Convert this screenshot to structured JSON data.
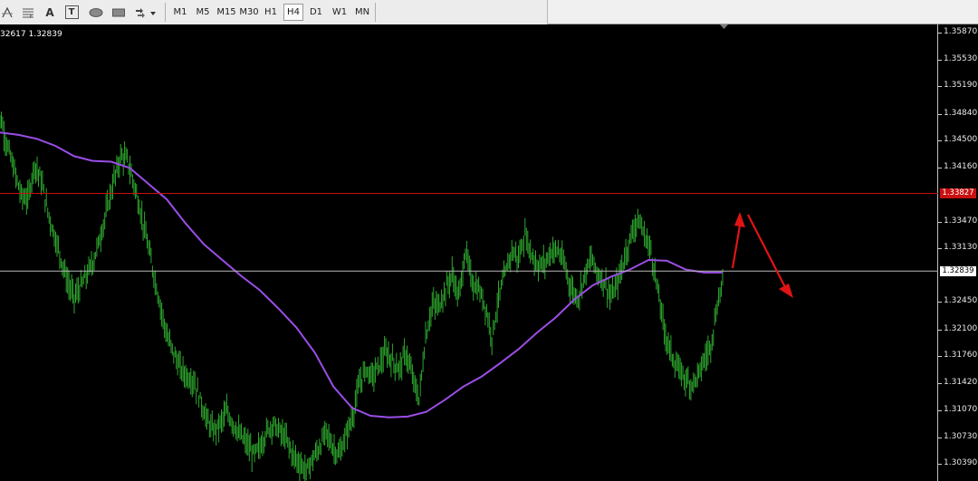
{
  "toolbar": {
    "tools": [
      {
        "name": "crosshair-icon"
      },
      {
        "name": "fibonacci-icon"
      },
      {
        "name": "text-icon",
        "label": "A"
      },
      {
        "name": "text-label-icon",
        "label": "T"
      },
      {
        "name": "ellipse-icon"
      },
      {
        "name": "rectangle-icon"
      },
      {
        "name": "arrows-icon"
      }
    ],
    "timeframes": [
      "M1",
      "M5",
      "M15",
      "M30",
      "H1",
      "H4",
      "D1",
      "W1",
      "MN"
    ],
    "active_timeframe": "H4"
  },
  "ohlc_text": "32617 1.32839",
  "chart_data": {
    "type": "line",
    "title": "",
    "y_axis_ticks": [
      "1.35870",
      "1.35530",
      "1.35190",
      "1.34840",
      "1.34500",
      "1.34160",
      "1.33470",
      "1.33130",
      "1.32450",
      "1.32100",
      "1.31760",
      "1.31420",
      "1.31070",
      "1.30730",
      "1.30390"
    ],
    "ylim": [
      1.302,
      1.36
    ],
    "horizontal_lines": [
      {
        "price": 1.33827,
        "label": "1.33827",
        "color": "#c81010"
      },
      {
        "price": 1.32839,
        "label": "1.32839",
        "color": "#b8b8b8"
      }
    ],
    "series": [
      {
        "style": "bars",
        "color": "#2ea82e",
        "values": [
          1.3475,
          1.344,
          1.341,
          1.338,
          1.3375,
          1.342,
          1.34,
          1.336,
          1.333,
          1.33,
          1.327,
          1.325,
          1.3265,
          1.328,
          1.33,
          1.333,
          1.3365,
          1.34,
          1.343,
          1.3425,
          1.3395,
          1.336,
          1.332,
          1.328,
          1.324,
          1.32,
          1.318,
          1.316,
          1.315,
          1.3145,
          1.312,
          1.3095,
          1.308,
          1.309,
          1.3105,
          1.309,
          1.3075,
          1.3065,
          1.305,
          1.306,
          1.308,
          1.309,
          1.308,
          1.307,
          1.305,
          1.304,
          1.303,
          1.3045,
          1.306,
          1.308,
          1.306,
          1.305,
          1.3075,
          1.31,
          1.314,
          1.316,
          1.315,
          1.3165,
          1.318,
          1.317,
          1.316,
          1.318,
          1.315,
          1.312,
          1.32,
          1.324,
          1.324,
          1.326,
          1.328,
          1.325,
          1.331,
          1.327,
          1.326,
          1.324,
          1.32,
          1.325,
          1.328,
          1.331,
          1.33,
          1.333,
          1.3305,
          1.329,
          1.3295,
          1.331,
          1.331,
          1.329,
          1.326,
          1.325,
          1.328,
          1.33,
          1.328,
          1.327,
          1.325,
          1.327,
          1.33,
          1.333,
          1.335,
          1.333,
          1.331,
          1.326,
          1.321,
          1.318,
          1.316,
          1.315,
          1.314,
          1.315,
          1.317,
          1.319,
          1.324,
          1.328
        ],
        "trend": [
          1.346,
          1.3457,
          1.3452,
          1.3443,
          1.343,
          1.3424,
          1.3423,
          1.3415,
          1.3395,
          1.3375,
          1.3345,
          1.3318,
          1.3298,
          1.3278,
          1.326,
          1.3237,
          1.3212,
          1.318,
          1.3137,
          1.311,
          1.31,
          1.3098,
          1.3099,
          1.3105,
          1.312,
          1.3137,
          1.315,
          1.3167,
          1.3185,
          1.3206,
          1.3225,
          1.3248,
          1.3266,
          1.3277,
          1.3286,
          1.3298,
          1.3297,
          1.3286,
          1.3282,
          1.3282
        ]
      }
    ],
    "annotations": [
      {
        "type": "arrow",
        "direction": "up",
        "color": "#e01414"
      },
      {
        "type": "arrow",
        "direction": "down",
        "color": "#e01414"
      }
    ],
    "grid": false
  }
}
